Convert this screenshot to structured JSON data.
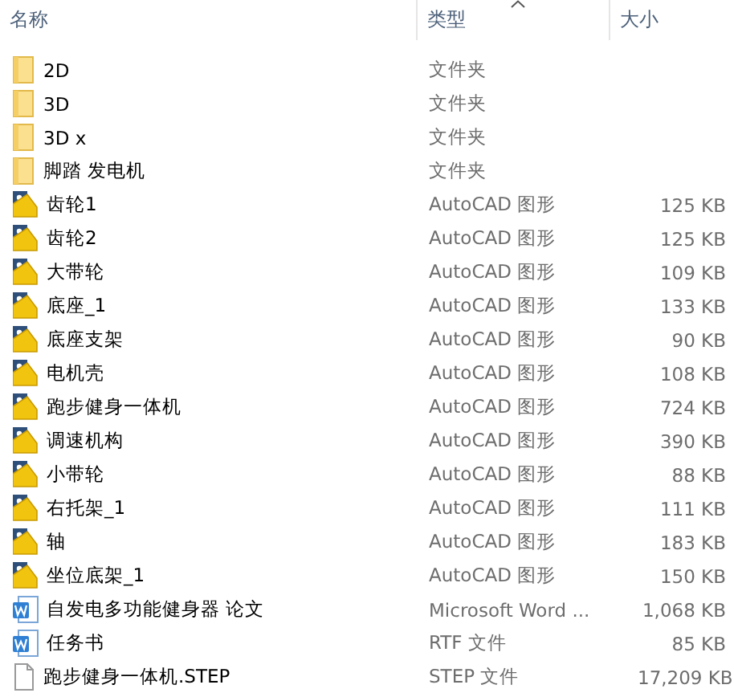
{
  "columns": [
    {
      "label": "名称",
      "sorted": false
    },
    {
      "label": "类型",
      "sorted": true
    },
    {
      "label": "大小",
      "sorted": false
    }
  ],
  "rows": [
    {
      "kind": "folder",
      "name": "2D",
      "type": "文件夹"
    },
    {
      "kind": "folder",
      "name": "3D",
      "type": "文件夹"
    },
    {
      "kind": "folder",
      "name": "3D x",
      "type": "文件夹"
    },
    {
      "kind": "folder",
      "name": "脚踏 发电机",
      "type": "文件夹"
    },
    {
      "kind": "cad",
      "name": "齿轮1",
      "type": "AutoCAD 图形",
      "size": "125 KB"
    },
    {
      "kind": "cad",
      "name": "齿轮2",
      "type": "AutoCAD 图形",
      "size": "125 KB"
    },
    {
      "kind": "cad",
      "name": "大带轮",
      "type": "AutoCAD 图形",
      "size": "109 KB"
    },
    {
      "kind": "cad",
      "name": "底座_1",
      "type": "AutoCAD 图形",
      "size": "133 KB"
    },
    {
      "kind": "cad",
      "name": "底座支架",
      "type": "AutoCAD 图形",
      "size": "90 KB"
    },
    {
      "kind": "cad",
      "name": "电机壳",
      "type": "AutoCAD 图形",
      "size": "108 KB"
    },
    {
      "kind": "cad",
      "name": "跑步健身一体机",
      "type": "AutoCAD 图形",
      "size": "724 KB"
    },
    {
      "kind": "cad",
      "name": "调速机构",
      "type": "AutoCAD 图形",
      "size": "390 KB"
    },
    {
      "kind": "cad",
      "name": "小带轮",
      "type": "AutoCAD 图形",
      "size": "88 KB"
    },
    {
      "kind": "cad",
      "name": "右托架_1",
      "type": "AutoCAD 图形",
      "size": "111 KB"
    },
    {
      "kind": "cad",
      "name": "轴",
      "type": "AutoCAD 图形",
      "size": "183 KB"
    },
    {
      "kind": "cad",
      "name": "坐位底架_1",
      "type": "AutoCAD 图形",
      "size": "150 KB"
    },
    {
      "kind": "word",
      "name": "自发电多功能健身器  论文",
      "type": "Microsoft Word ...",
      "size": "1,068 KB"
    },
    {
      "kind": "word",
      "name": "任务书",
      "type": "RTF 文件",
      "size": "85 KB"
    },
    {
      "kind": "file",
      "name": "跑步健身一体机.STEP",
      "type": "STEP 文件",
      "size": "17,209 KB"
    }
  ]
}
